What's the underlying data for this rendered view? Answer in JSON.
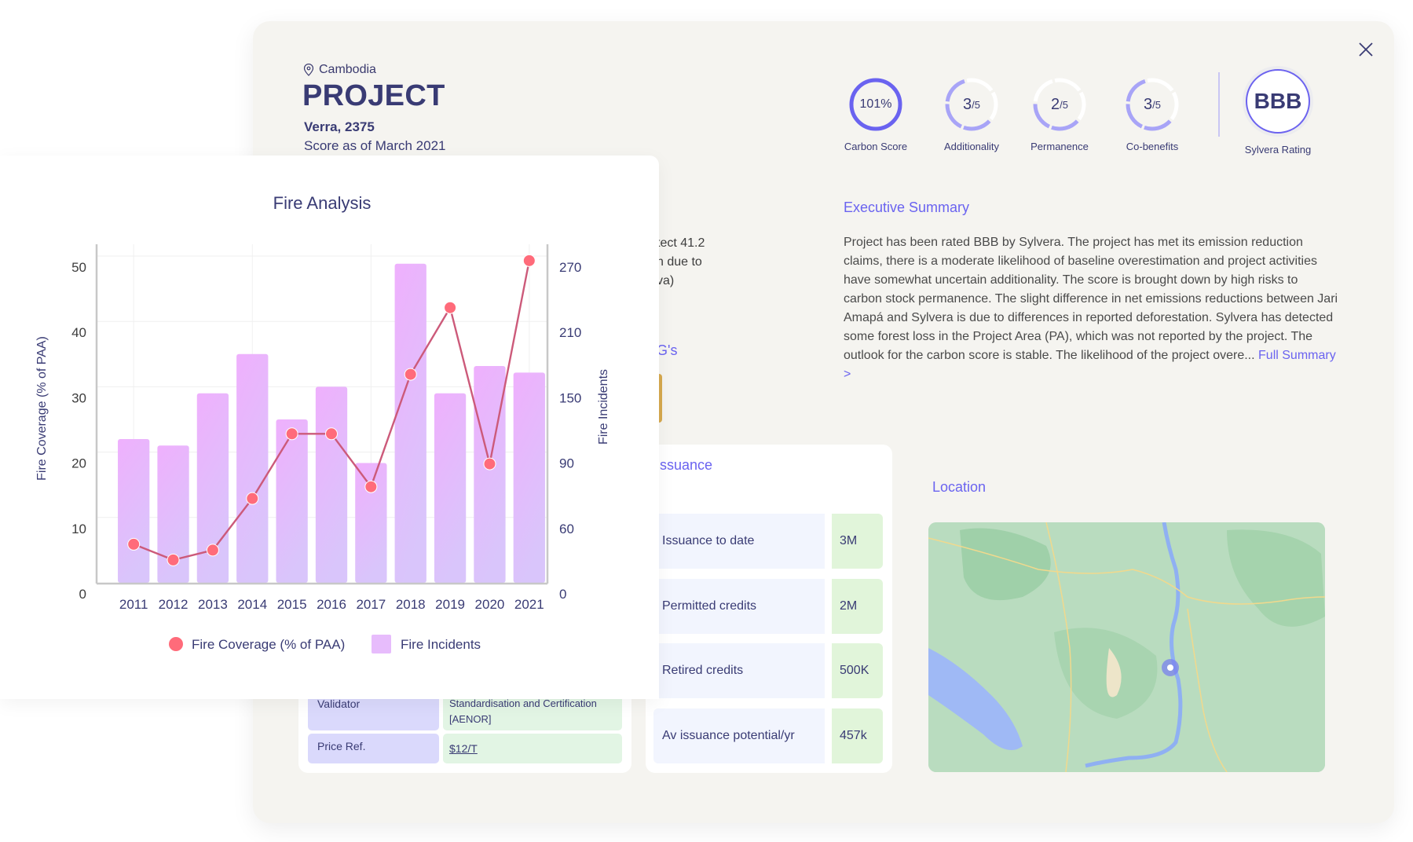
{
  "project": {
    "location": "Cambodia",
    "title": "PROJECT",
    "registry_line": "Verra, 2375",
    "score_date": "Score as of March 2021"
  },
  "scores": [
    {
      "label": "Carbon Score",
      "value": "101%",
      "type": "percent",
      "fraction": 1.0
    },
    {
      "label": "Additionality",
      "value": "3",
      "max": "/5",
      "type": "segmented",
      "filled": 3,
      "segments": 5
    },
    {
      "label": "Permanence",
      "value": "2",
      "max": "/5",
      "type": "segmented",
      "filled": 2,
      "segments": 5
    },
    {
      "label": "Co-benefits",
      "value": "3",
      "max": "/5",
      "type": "segmented",
      "filled": 3,
      "segments": 5
    }
  ],
  "rating": {
    "label": "Sylvera Rating",
    "value": "BBB"
  },
  "close_icon": "close-icon",
  "executive_summary": {
    "title": "Executive Summary",
    "text": "Project has been rated BBB by Sylvera. The project has met its emission reduction claims, there is a moderate likelihood of baseline overestimation and project activities have somewhat uncertain additionality. The score is brought down by high risks to carbon stock permanence. The slight difference in net emissions reductions between Jari Amapá and Sylvera is due to differences in reported deforestation. Sylvera has detected some forest loss in the Project Area (PA), which was not reported by the project. The outlook for the carbon score is stable. The likelihood of the project overe...",
    "link": "Full Summary >"
  },
  "partially_hidden": {
    "lines": [
      "tect 41.2",
      "n due to",
      "va)"
    ],
    "sdg_heading": "G's"
  },
  "details": [
    {
      "key": "Validator",
      "value": "Standardisation and Certification [AENOR]"
    },
    {
      "key": "Price Ref.",
      "value": "$12/T",
      "link": true
    }
  ],
  "issuance": {
    "title": "ssuance",
    "rows": [
      {
        "key": "Issuance to date",
        "value": "3M"
      },
      {
        "key": "Permitted credits",
        "value": "2M"
      },
      {
        "key": "Retired credits",
        "value": "500K"
      },
      {
        "key": "Av issuance potential/yr",
        "value": "457k"
      }
    ]
  },
  "location_section": {
    "title": "Location"
  },
  "colors": {
    "accent": "#6a63f0",
    "title": "#393b74",
    "line": "#d0566e",
    "point": "#ff6b7a",
    "bar_top": "#efb0fd",
    "bar_bottom": "#d9c5fb",
    "panel_bg": "#f5f4f0"
  },
  "chart_data": {
    "type": "bar",
    "title": "Fire Analysis",
    "categories": [
      "2011",
      "2012",
      "2013",
      "2014",
      "2015",
      "2016",
      "2017",
      "2018",
      "2019",
      "2020",
      "2021"
    ],
    "series": [
      {
        "name": "Fire Incidents",
        "type": "bar",
        "axis": "right",
        "values": [
          102,
          96,
          144,
          180,
          120,
          150,
          85,
          263,
          144,
          169,
          163
        ]
      },
      {
        "name": "Fire Coverage (% of PAA)",
        "type": "line",
        "axis": "left",
        "values": [
          5.9,
          3.5,
          5.0,
          12.9,
          22.8,
          22.8,
          14.7,
          31.9,
          42.1,
          18.2,
          49.3
        ]
      }
    ],
    "ylabel": "Fire Coverage (% of PAA)",
    "y2label": "Fire Incidents",
    "xlabel": "",
    "ylim": [
      0,
      50
    ],
    "y_ticks": [
      "0",
      "10",
      "20",
      "30",
      "40",
      "50"
    ],
    "y2_ticks": [
      "0",
      "60",
      "90",
      "150",
      "210",
      "270"
    ],
    "grid": true,
    "legend": [
      {
        "label": "Fire Coverage (% of PAA)",
        "marker": "circle"
      },
      {
        "label": "Fire Incidents",
        "marker": "square"
      }
    ],
    "legend_position": "bottom"
  }
}
